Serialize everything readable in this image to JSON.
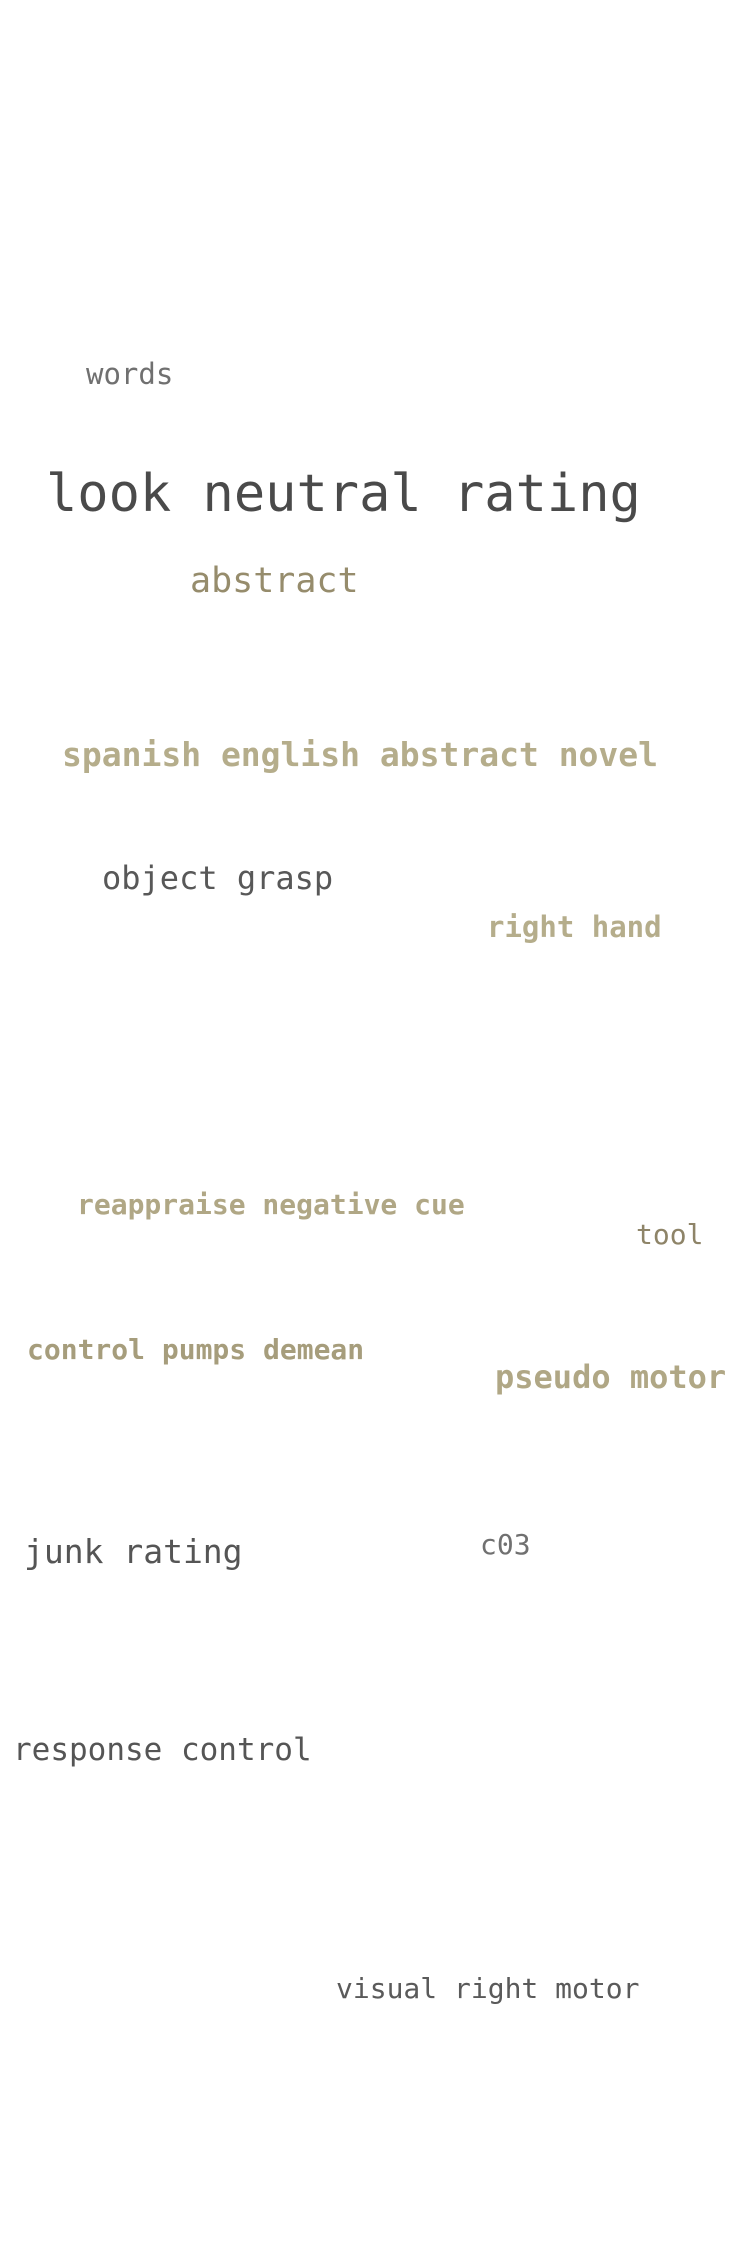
{
  "cloud": {
    "words": "words",
    "look_neutral_rating": "look neutral rating",
    "abstract": "abstract",
    "spanish_english_abstract_novel": "spanish english abstract novel",
    "object_grasp": "object grasp",
    "right_hand": "right hand",
    "reappraise_negative_cue": "reappraise negative cue",
    "tool": "tool",
    "control_pumps_demean": "control pumps demean",
    "pseudo_motor": "pseudo motor",
    "junk_rating": "junk rating",
    "c03": "c03",
    "response_control": "response control",
    "visual_right_motor": "visual right motor"
  },
  "colors": {
    "dark_gray": "#505050",
    "olive": "#9a9071",
    "tan": "#b8b08e",
    "background": "#ffffff"
  }
}
